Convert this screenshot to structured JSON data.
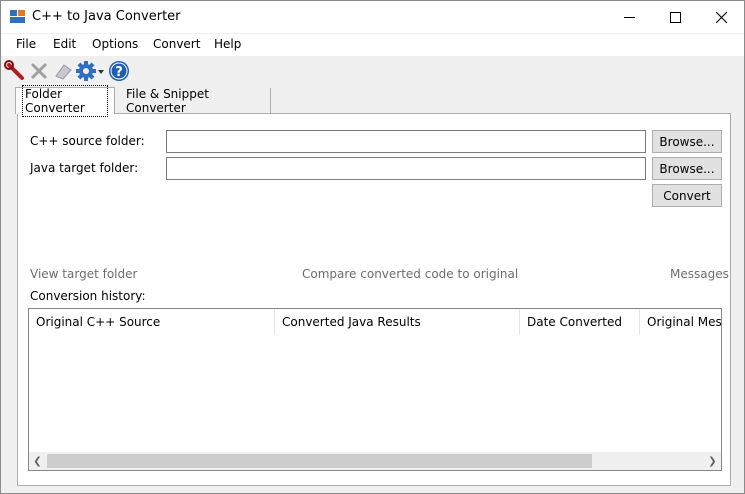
{
  "window": {
    "title": "C++ to Java Converter"
  },
  "menu": [
    "File",
    "Edit",
    "Options",
    "Convert",
    "Help"
  ],
  "toolbar": {
    "icons": [
      "wrench-icon",
      "delete-icon",
      "eraser-icon",
      "gear-icon",
      "help-icon"
    ]
  },
  "tabs": [
    {
      "label": "Folder Converter",
      "active": true
    },
    {
      "label": "File & Snippet Converter",
      "active": false
    }
  ],
  "folder": {
    "source_label": "C++ source folder:",
    "source_value": "",
    "target_label": "Java target folder:",
    "target_value": "",
    "browse_label": "Browse...",
    "convert_label": "Convert"
  },
  "links": {
    "view_target": "View target folder",
    "compare": "Compare converted code to original",
    "messages": "Messages"
  },
  "history": {
    "label": "Conversion history:",
    "columns": [
      "Original C++ Source",
      "Converted Java Results",
      "Date Converted",
      "Original Messa"
    ]
  },
  "colors": {
    "background": "#f0f0f0",
    "link_gray": "#6d6d6d",
    "help_blue": "#1e5fb4"
  }
}
